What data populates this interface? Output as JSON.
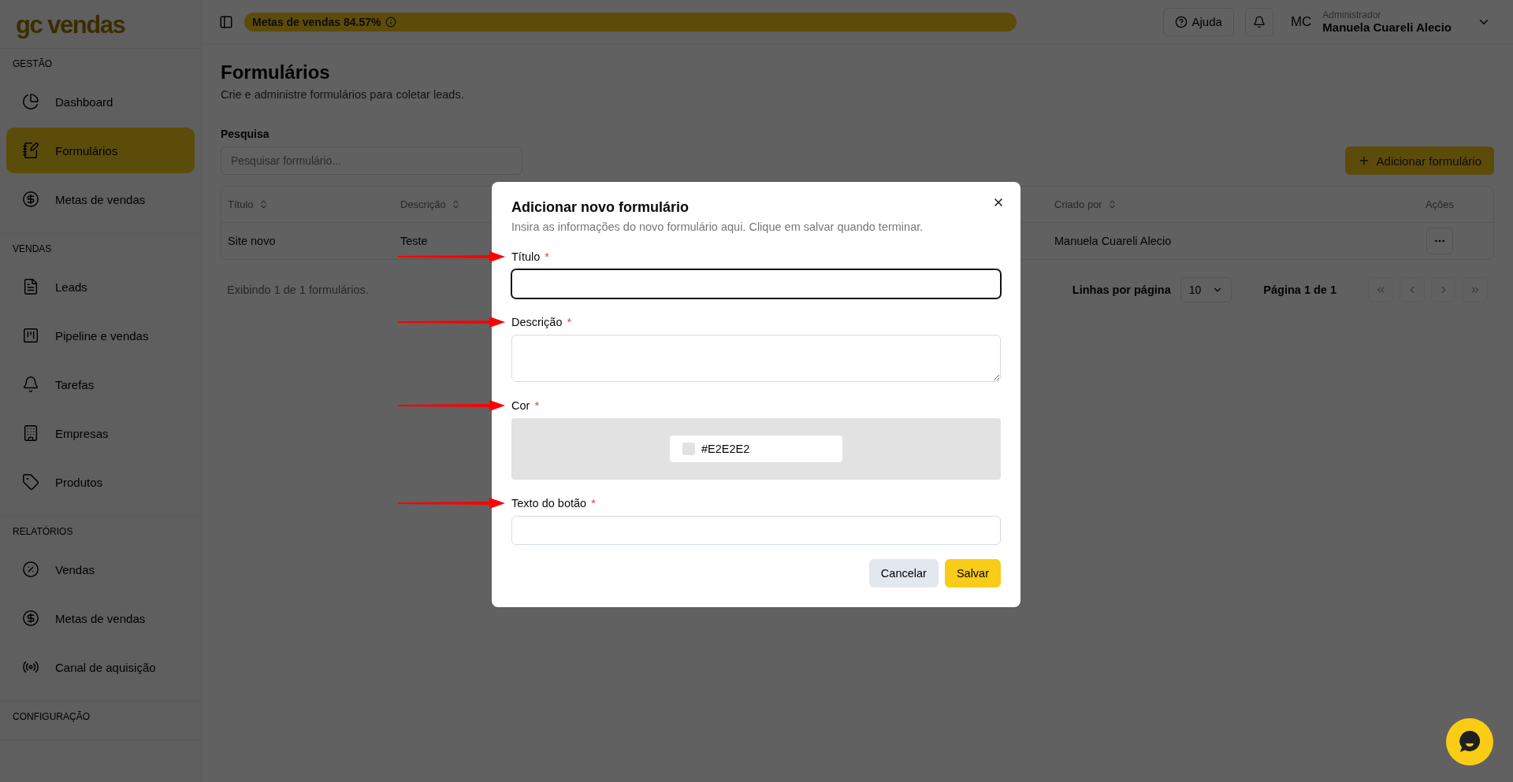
{
  "logo": {
    "text": "gc vendas"
  },
  "sidebar": {
    "sections": [
      {
        "title": "GESTÃO",
        "items": [
          {
            "label": "Dashboard",
            "kind": "pie",
            "selected": false
          },
          {
            "label": "Formulários",
            "kind": "notebook",
            "selected": true
          },
          {
            "label": "Metas de vendas",
            "kind": "dollar",
            "selected": false
          }
        ]
      },
      {
        "title": "VENDAS",
        "items": [
          {
            "label": "Leads",
            "kind": "file",
            "selected": false
          },
          {
            "label": "Pipeline e vendas",
            "kind": "kanban",
            "selected": false
          },
          {
            "label": "Tarefas",
            "kind": "bell",
            "selected": false
          },
          {
            "label": "Empresas",
            "kind": "building",
            "selected": false
          },
          {
            "label": "Produtos",
            "kind": "tag",
            "selected": false
          }
        ]
      },
      {
        "title": "RELATÓRIOS",
        "items": [
          {
            "label": "Vendas",
            "kind": "percent",
            "selected": false
          },
          {
            "label": "Metas de vendas",
            "kind": "dollar",
            "selected": false
          },
          {
            "label": "Canal de aquisição",
            "kind": "radio",
            "selected": false
          }
        ]
      },
      {
        "title": "CONFIGURAÇÃO"
      }
    ]
  },
  "header": {
    "goal": "Metas de vendas 84.57%",
    "help": "Ajuda",
    "user": {
      "initials": "MC",
      "role": "Administrador",
      "name": "Manuela Cuareli Alecio"
    }
  },
  "page": {
    "title": "Formulários",
    "subtitle": "Crie e administre formulários para coletar leads.",
    "search_label": "Pesquisa",
    "search_placeholder": "Pesquisar formulário...",
    "add_button": "Adicionar formulário"
  },
  "table": {
    "columns": [
      {
        "label": "Título",
        "sortable": true
      },
      {
        "label": "Descrição",
        "sortable": true
      },
      {
        "label": "Criado por",
        "sortable": true
      },
      {
        "label": "Ações",
        "sortable": false
      }
    ],
    "rows": [
      {
        "cells": [
          "Site novo",
          "Teste",
          "Manuela Cuareli Alecio"
        ]
      }
    ]
  },
  "footer": {
    "summary": "Exibindo 1 de 1 formulários.",
    "rows_label": "Linhas por página",
    "rows_value": "10",
    "page": "Página 1 de 1"
  },
  "modal": {
    "title": "Adicionar novo formulário",
    "description": "Insira as informações do novo formulário aqui. Clique em salvar quando terminar.",
    "fields": [
      {
        "label": "Título",
        "required": "*",
        "kind": "input",
        "focused": true,
        "arrow": true
      },
      {
        "label": "Descrição",
        "required": "*",
        "kind": "textarea",
        "focused": false,
        "arrow": true
      },
      {
        "label": "Cor",
        "required": "*",
        "kind": "color",
        "value": "#E2E2E2",
        "color": "#e2e2e2",
        "focused": false,
        "arrow": true
      },
      {
        "label": "Texto do botão",
        "required": "*",
        "kind": "input",
        "focused": false,
        "arrow": true
      }
    ],
    "cancel": "Cancelar",
    "save": "Salvar"
  }
}
